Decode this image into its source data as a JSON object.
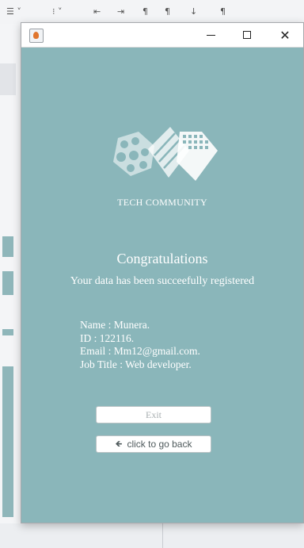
{
  "window": {
    "app_icon": "java-icon",
    "minimize_icon": "minimize-icon",
    "maximize_icon": "maximize-icon",
    "close_glyph": "✕"
  },
  "brand": {
    "logo_icon": "tech-community-logo",
    "name": "TECH COMMUNITY"
  },
  "message": {
    "heading": "Congratulations",
    "subheading": "Your data has been succeefully registered"
  },
  "details": {
    "name": "Name : Munera.",
    "id": "ID : 122116.",
    "email": "Email : Mm12@gmail.com.",
    "job_title": "Job Title : Web developer."
  },
  "buttons": {
    "exit_label": "Exit",
    "back_icon": "back-arrow-icon",
    "back_label": "click to go back"
  },
  "colors": {
    "window_background": "#8ab6ba",
    "text": "#ffffff"
  }
}
